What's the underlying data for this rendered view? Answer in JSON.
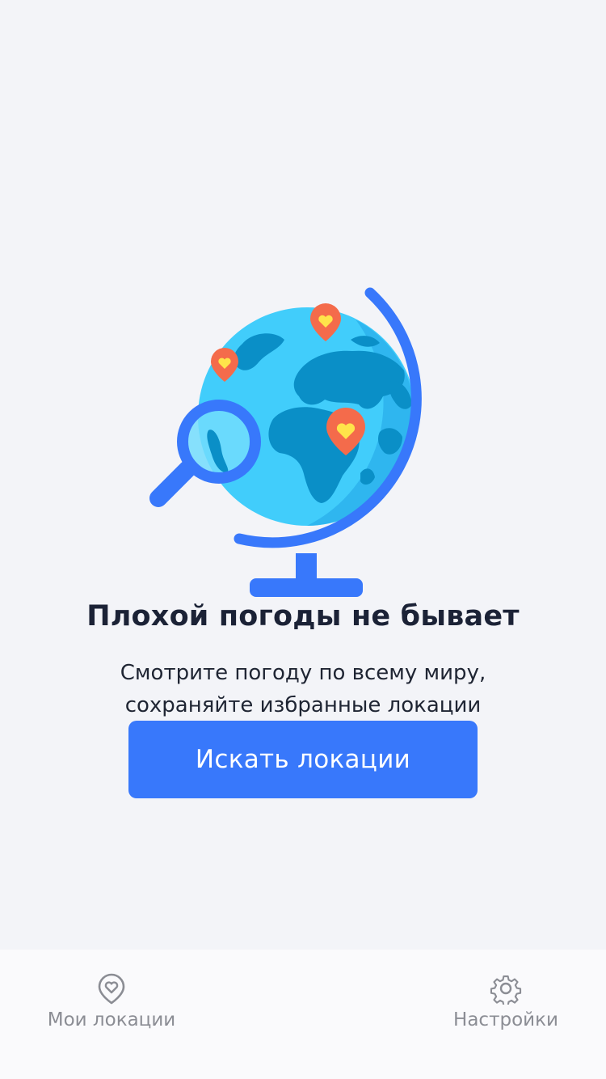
{
  "empty_state": {
    "title": "Плохой погоды не бывает",
    "subtitle_lines": [
      "Смотрите погоду по всему миру,",
      "сохраняйте избранные локации"
    ],
    "button_label": "Искать локации"
  },
  "illustration": {
    "subject": "globe-with-location-pins-and-magnifier",
    "colors": {
      "ocean": "#41cdfb",
      "land": "#0a8fc7",
      "frame": "#3878fb",
      "pin": "#f46b4b",
      "heart": "#ffe44a"
    }
  },
  "tab_bar": {
    "items": [
      {
        "label": "Мои локации",
        "icon": "heart-pin-icon"
      },
      {
        "label": "Настройки",
        "icon": "gear-icon"
      }
    ]
  },
  "colors": {
    "background": "#f3f4f8",
    "accent": "#3878fb",
    "title_text": "#1b2236",
    "tab_text": "#8b8d94"
  }
}
